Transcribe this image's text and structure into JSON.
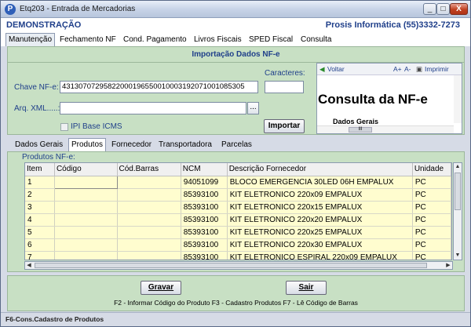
{
  "window": {
    "title": "Etq203 - Entrada de Mercadorias",
    "minimize": "_",
    "maximize": "□",
    "close": "X"
  },
  "header": {
    "mode": "DEMONSTRAÇÃO",
    "company": "Prosis Informática (55)3332-7273"
  },
  "tabs": [
    "Manutenção",
    "Fechamento NF",
    "Cond. Pagamento",
    "Livros Fiscais",
    "SPED Fiscal",
    "Consulta"
  ],
  "import_panel": {
    "title": "Importação Dados NF-e",
    "chave_label": "Chave NF-e:",
    "chave_value": "43130707295822000196550010003192071001085305",
    "caracteres_label": "Caracteres:",
    "caracteres_value": "",
    "arq_label": "Arq. XML.....:",
    "arq_value": "",
    "browse_label": "...",
    "ipi_label": "IPI Base ICMS",
    "importar_label": "Importar"
  },
  "browser": {
    "back": "Voltar",
    "font_up": "A+",
    "font_down": "A-",
    "print": "Imprimir",
    "heading": "Consulta da NF-e",
    "subheading": "Dados Gerais",
    "hscroll_label": "III"
  },
  "subtabs": [
    "Dados Gerais",
    "Produtos",
    "Fornecedor",
    "Transportadora",
    "Parcelas"
  ],
  "grid": {
    "label": "Produtos NF-e:",
    "columns": [
      "Item",
      "Código",
      "Cód.Barras",
      "NCM",
      "Descrição Fornecedor",
      "Unidade"
    ],
    "rows": [
      [
        "1",
        "",
        "",
        "94051099",
        "BLOCO EMERGENCIA 30LED 06H EMPALUX",
        "PC"
      ],
      [
        "2",
        "",
        "",
        "85393100",
        "KIT ELETRONICO 220x09 EMPALUX",
        "PC"
      ],
      [
        "3",
        "",
        "",
        "85393100",
        "KIT ELETRONICO 220x15 EMPALUX",
        "PC"
      ],
      [
        "4",
        "",
        "",
        "85393100",
        "KIT ELETRONICO 220x20 EMPALUX",
        "PC"
      ],
      [
        "5",
        "",
        "",
        "85393100",
        "KIT ELETRONICO 220x25 EMPALUX",
        "PC"
      ],
      [
        "6",
        "",
        "",
        "85393100",
        "KIT ELETRONICO 220x30 EMPALUX",
        "PC"
      ],
      [
        "7",
        "",
        "",
        "85393100",
        "KIT ELETRONICO ESPIRAL 220x09 EMPALUX",
        "PC"
      ]
    ]
  },
  "buttons": {
    "gravar": "Gravar",
    "sair": "Sair"
  },
  "hint": "F2 - Informar Código do Produto  F3 - Cadastro Produtos F7 - Lê Código de Barras",
  "status": "F6-Cons.Cadastro de Produtos",
  "colors": {
    "panel_green": "#c8e0c4",
    "label_blue": "#1f3f8a",
    "row_yellow": "#fffdcf"
  }
}
